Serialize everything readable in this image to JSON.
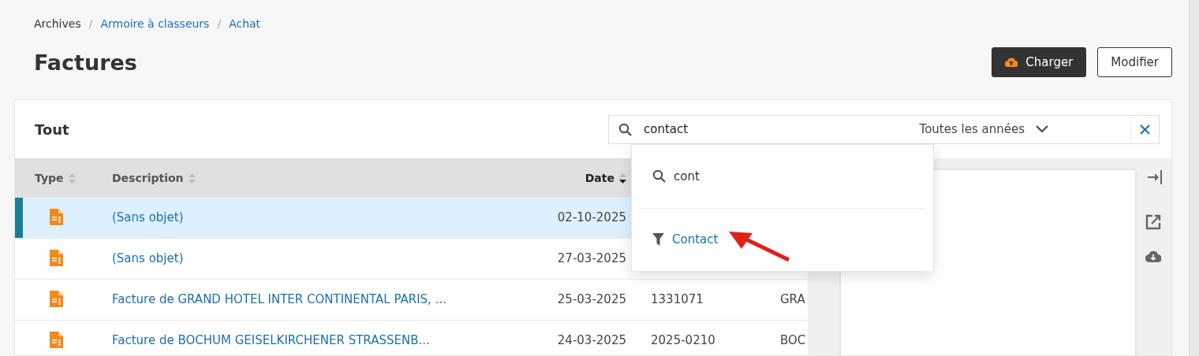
{
  "breadcrumb": [
    {
      "label": "Archives",
      "link": false
    },
    {
      "separator": "/",
      "label": "Armoire à classeurs",
      "link": true
    },
    {
      "separator": "/",
      "label": "Achat",
      "link": true
    }
  ],
  "page_title": "Factures",
  "actions": [
    {
      "label": "Charger",
      "kind": "primary"
    },
    {
      "label": "Modifier",
      "kind": "secondary"
    }
  ],
  "card_title": "Tout",
  "search": {
    "value": "contact",
    "year_filter": "Toutes les années"
  },
  "suggestions": [
    {
      "kind": "search",
      "label": "cont"
    },
    {
      "kind": "filter",
      "label": "Contact"
    }
  ],
  "table": {
    "columns": [
      {
        "label": "Type",
        "sorted": false
      },
      {
        "label": "Description",
        "sorted": false
      },
      {
        "label": "Date",
        "sorted": true
      }
    ],
    "rows": [
      {
        "selected": true,
        "description": "(Sans objet)",
        "date": "02-10-2025"
      },
      {
        "selected": false,
        "description": "(Sans objet)",
        "date": "27-03-2025"
      },
      {
        "selected": false,
        "description": "Facture de GRAND HOTEL INTER CONTINENTAL PARIS, ...",
        "date": "25-03-2025",
        "column_3": "1331071",
        "column_4": "GRA"
      },
      {
        "selected": false,
        "description": "Facture de BOCHUM GEISELKIRCHENER STRASSENB...",
        "date": "24-03-2025",
        "column_3": "2025-0210",
        "column_4": "BOC"
      }
    ]
  }
}
